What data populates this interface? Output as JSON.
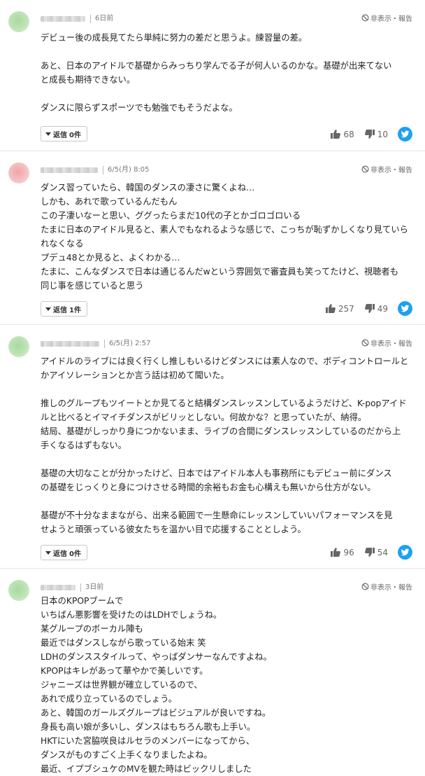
{
  "labels": {
    "report": "非表示・報告",
    "reply_prefix": "返信"
  },
  "comments": [
    {
      "time": "6日前",
      "paragraphs": [
        [
          "デビュー後の成長見てたら単純に努力の差だと思うよ。練習量の差。"
        ],
        [
          "あと、日本のアイドルで基礎からみっちり学んでる子が何人いるのかな。基礎が出来てない",
          "と成長も期待できない。"
        ],
        [
          "ダンスに限らずスポーツでも勉強でもそうだよな。"
        ]
      ],
      "replies": "0件",
      "likes": "68",
      "dislikes": "10"
    },
    {
      "time": "6/5(月) 8:05",
      "paragraphs": [
        [
          "ダンス習っていたら、韓国のダンスの凄さに驚くよね…",
          "しかも、あれで歌っているんだもん",
          "この子凄いなーと思い、ググったらまだ10代の子とかゴロゴロいる",
          "たまに日本のアイドル見ると、素人でもなれるような感じで、こっちが恥ずかしくなり見ていら",
          "れなくなる",
          "プデュ48とか見ると、よくわかる…",
          "たまに、こんなダンスで日本は通じるんだwという雰囲気で審査員も笑ってたけど、視聴者も",
          "同じ事を感じていると思う"
        ]
      ],
      "replies": "1件",
      "likes": "257",
      "dislikes": "49"
    },
    {
      "time": "6/5(月) 2:57",
      "paragraphs": [
        [
          "アイドルのライブには良く行くし推しもいるけどダンスには素人なので、ボディコントロールと",
          "かアイソレーションとか言う話は初めて聞いた。"
        ],
        [
          "推しのグループもツイートとか見てると結構ダンスレッスンしているようだけど、K-popアイド",
          "ルと比べるとイマイチダンスがビリッとしない。何故かな？と思っていたが、納得。",
          "結局、基礎がしっかり身につかないまま、ライブの合間にダンスレッスンしているのだから上",
          "手くなるはずもない。"
        ],
        [
          "基礎の大切なことが分かったけど、日本ではアイドル本人も事務所にもデビュー前にダンス",
          "の基礎をじっくりと身につけさせる時間的余裕もお金も心構えも無いから仕方がない。"
        ],
        [
          "基礎が不十分なままながら、出来る範囲で一生懸命にレッスンしていいパフォーマンスを見",
          "せようと頑張っている彼女たちを温かい目で応援することとしよう。"
        ]
      ],
      "replies": "0件",
      "likes": "96",
      "dislikes": "54"
    },
    {
      "time": "3日前",
      "paragraphs": [
        [
          "日本のKPOPブームで",
          "いちばん悪影響を受けたのはLDHでしょうね。",
          "某グループのボーカル陣も",
          "最近ではダンスしながら歌っている始末 笑",
          "LDHのダンススタイルって、やっぱダンサーなんですよね。",
          "KPOPはキレがあって華やかで美しいです。",
          "ジャニーズは世界観が確立しているので、",
          "あれで成り立っているのでしょう。",
          "あと、韓国のガールズグループはビジュアルが良いですね。",
          "身長も高い娘が多いし、ダンスはもちろん歌も上手い。",
          "HKTにいた宮脇咲良はルセラのメンバーになってから、",
          "ダンスがものすごく上手くなりましたよね。",
          "最近、イプブシュケのMVを観た時はビックリしました"
        ]
      ]
    }
  ]
}
